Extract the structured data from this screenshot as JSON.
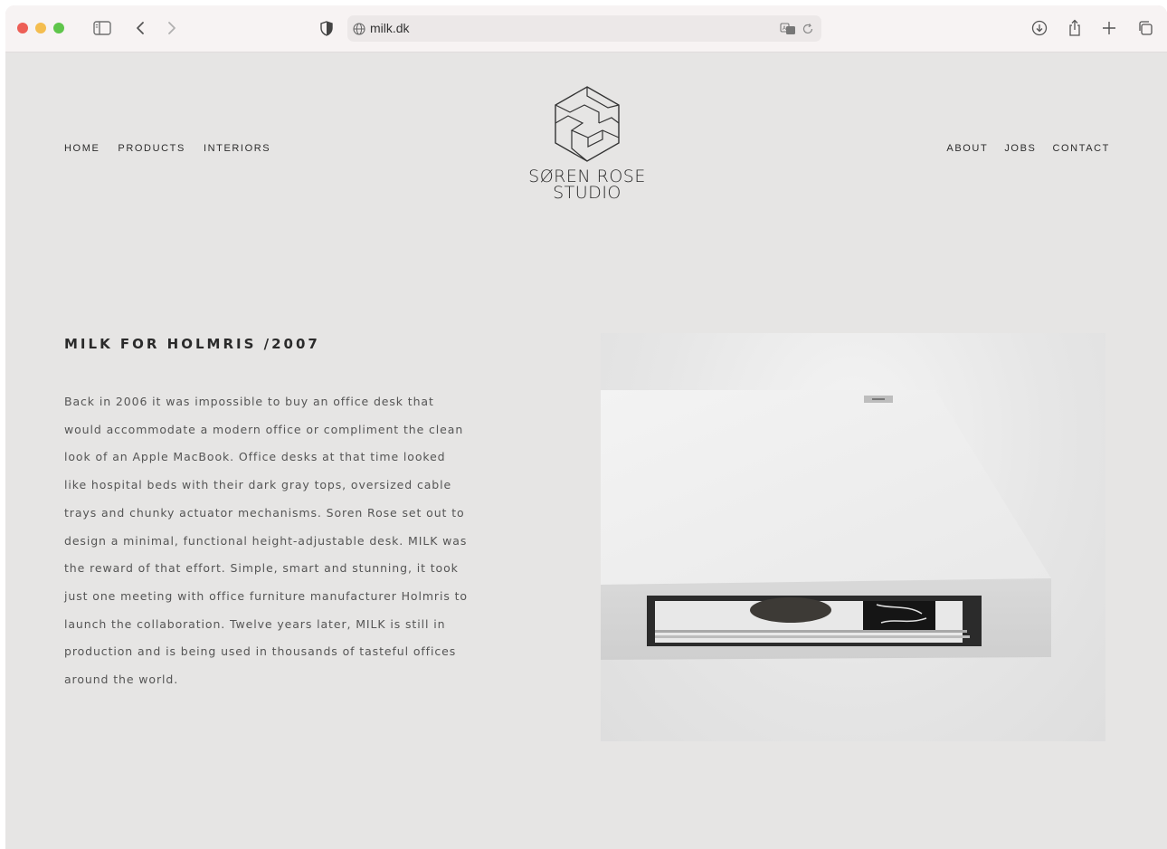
{
  "browser": {
    "url": "milk.dk",
    "icons": [
      "sidebar-icon",
      "back-icon",
      "forward-icon",
      "shield-icon",
      "globe-icon",
      "translate-icon",
      "reload-icon",
      "download-icon",
      "share-icon",
      "new-tab-icon",
      "tab-overview-icon"
    ]
  },
  "nav": {
    "left": [
      "HOME",
      "PRODUCTS",
      "INTERIORS"
    ],
    "right": [
      "ABOUT",
      "JOBS",
      "CONTACT"
    ]
  },
  "logo": {
    "line1": "SØREN ROSE",
    "line2": "STUDIO"
  },
  "article": {
    "title": "MILK FOR HOLMRIS /2007",
    "lines": [
      "Back in 2006 it was impossible to buy an office desk that",
      "would accommodate a modern office or compliment the clean",
      "look of an Apple MacBook. Office desks at that time looked",
      "like hospital beds with their dark gray tops, oversized cable",
      "trays and chunky actuator mechanisms. Soren Rose set out to",
      "design a minimal, functional height-adjustable desk. MILK was",
      "the reward of that effort. Simple, smart and stunning, it took",
      "just one meeting with office furniture manufacturer Holmris to",
      "launch the collaboration. Twelve years later, MILK is still in",
      "production and is being used in thousands of tasteful offices",
      "around the world."
    ]
  },
  "colors": {
    "background": "#e6e5e4",
    "text": "#555555",
    "toolbar": "#f7f3f3"
  }
}
